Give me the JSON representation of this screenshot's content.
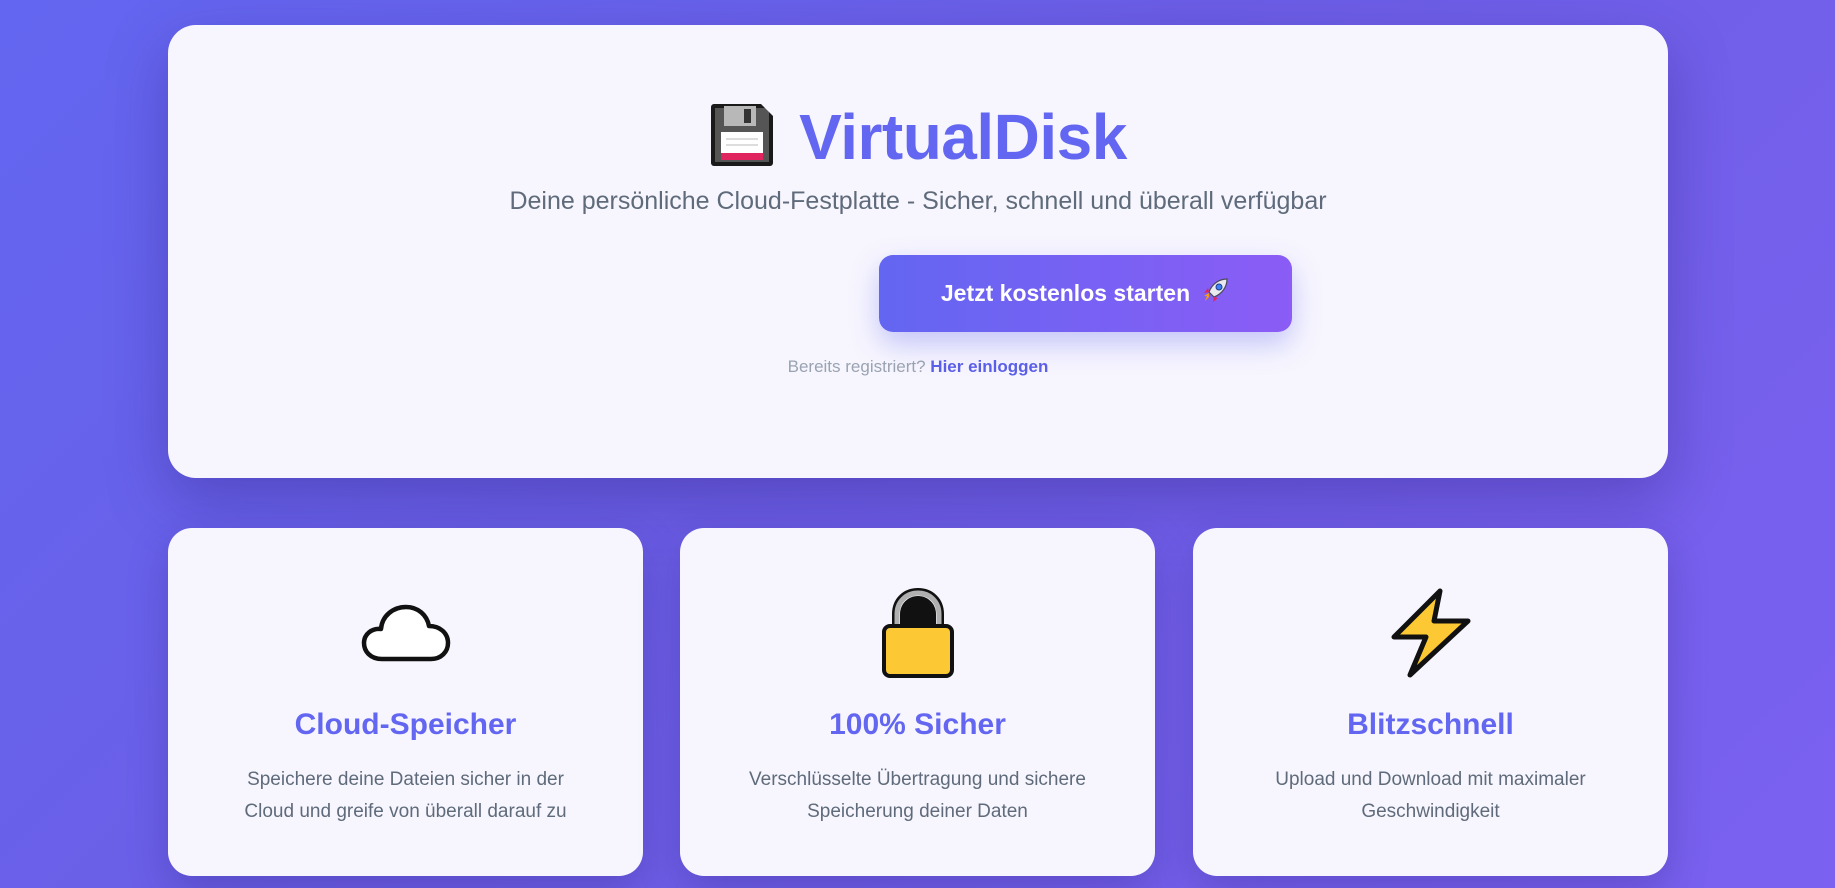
{
  "hero": {
    "title": "VirtualDisk",
    "logo_icon": "floppy-disk-icon",
    "subtitle": "Deine persönliche Cloud-Festplatte - Sicher, schnell und überall verfügbar",
    "cta_label": "Jetzt kostenlos starten",
    "cta_icon": "rocket-icon",
    "login_prompt": "Bereits registriert?",
    "login_link": "Hier einloggen"
  },
  "features": [
    {
      "icon": "cloud-icon",
      "title": "Cloud-Speicher",
      "text": "Speichere deine Dateien sicher in der Cloud und greife von überall darauf zu"
    },
    {
      "icon": "lock-icon",
      "title": "100% Sicher",
      "text": "Verschlüsselte Übertragung und sichere Speicherung deiner Daten"
    },
    {
      "icon": "lightning-icon",
      "title": "Blitzschnell",
      "text": "Upload und Download mit maximaler Geschwindigkeit"
    }
  ],
  "colors": {
    "accent": "#6366f1",
    "accent_end": "#8b5cf6",
    "card_bg": "#f7f6fe",
    "muted_text": "#5f6b7a"
  }
}
